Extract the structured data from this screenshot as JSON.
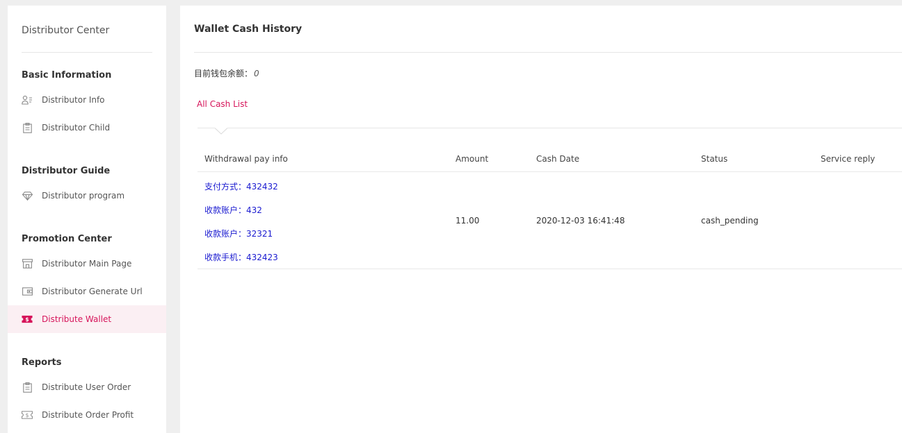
{
  "sidebar": {
    "title": "Distributor Center",
    "sections": [
      {
        "heading": "Basic Information",
        "items": [
          {
            "label": "Distributor Info",
            "icon": "user-card-icon"
          },
          {
            "label": "Distributor Child",
            "icon": "clipboard-icon"
          }
        ]
      },
      {
        "heading": "Distributor Guide",
        "items": [
          {
            "label": "Distributor program",
            "icon": "diamond-icon"
          }
        ]
      },
      {
        "heading": "Promotion Center",
        "items": [
          {
            "label": "Distributor Main Page",
            "icon": "storefront-icon"
          },
          {
            "label": "Distributor Generate Url",
            "icon": "wallet-icon"
          },
          {
            "label": "Distribute Wallet",
            "icon": "dollar-ticket-icon",
            "active": true
          }
        ]
      },
      {
        "heading": "Reports",
        "items": [
          {
            "label": "Distribute User Order",
            "icon": "clipboard-icon"
          },
          {
            "label": "Distribute Order Profit",
            "icon": "dollar-ticket-icon"
          }
        ]
      }
    ]
  },
  "main": {
    "title": "Wallet Cash History",
    "balance_label": "目前钱包余额：",
    "balance_value": "0",
    "tab": "All Cash List",
    "table": {
      "columns": [
        "Withdrawal pay info",
        "Amount",
        "Cash Date",
        "Status",
        "Service reply"
      ],
      "rows": [
        {
          "pay_info": [
            "支付方式：432432",
            "收款账户：432",
            "收款账户：32321",
            "收款手机：432423"
          ],
          "amount": "11.00",
          "cash_date": "2020-12-03 16:41:48",
          "status": "cash_pending",
          "service_reply": ""
        }
      ]
    }
  },
  "colors": {
    "accent": "#d6145a",
    "active_bg": "#fbeff3",
    "link": "#1a1ad0",
    "page_bg": "#efefef"
  }
}
